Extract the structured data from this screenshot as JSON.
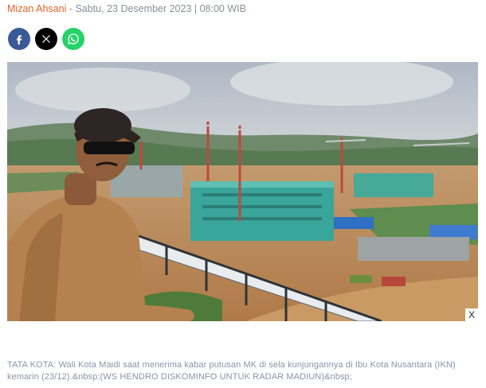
{
  "byline": {
    "author": "Mizan Ahsani",
    "separator": " - ",
    "datetime": "Sabtu, 23 Desember 2023 | 08:00 WIB"
  },
  "share": [
    {
      "name": "facebook",
      "icon": "facebook-icon",
      "color": "#3b5998"
    },
    {
      "name": "x",
      "icon": "x-icon",
      "color": "#000000"
    },
    {
      "name": "whatsapp",
      "icon": "whatsapp-icon",
      "color": "#25d366"
    }
  ],
  "photo": {
    "close_label": "X"
  },
  "caption": {
    "text": "TATA KOTA: Wali Kota Maidi saat menerima kabar putusan MK di sela kunjungannya di Ibu Kota Nusantara (IKN) kemarin (23/12).&nbsp;(WS HENDRO DISKOMINFO UNTUK RADAR MADIUN)&nbsp;"
  },
  "colors": {
    "author": "#e0622a",
    "meta": "#8a8f99",
    "caption": "#8a93a6"
  }
}
